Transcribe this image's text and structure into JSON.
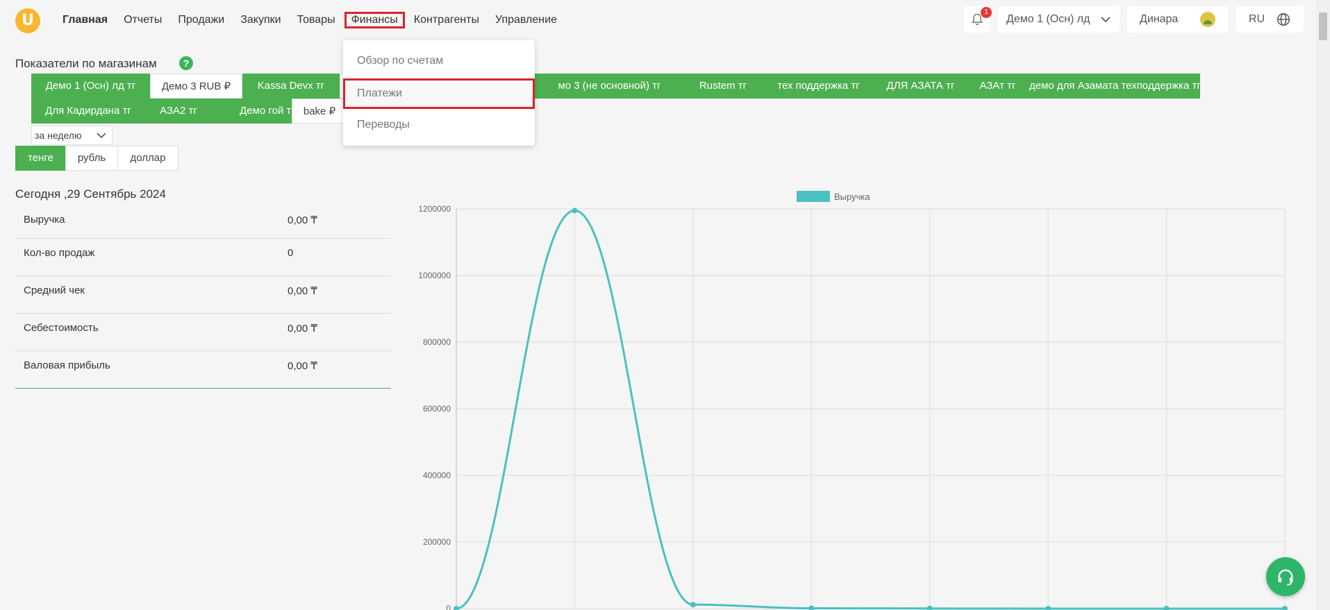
{
  "header": {
    "logo_letter": "U",
    "nav": [
      "Главная",
      "Отчеты",
      "Продажи",
      "Закупки",
      "Товары",
      "Финансы",
      "Контрагенты",
      "Управление"
    ],
    "notifications_count": "1",
    "store_selector": "Демо 1 (Осн) лд",
    "user_name": "Динара",
    "language": "RU"
  },
  "finance_menu": {
    "items": [
      "Обзор по счетам",
      "Платежи",
      "Переводы"
    ]
  },
  "section": {
    "title": "Показатели по магазинам",
    "help": "?"
  },
  "store_tabs": [
    "Демо 1 (Осн) лд тг",
    "Демо 3 RUB ₽",
    "Kassa Devx тг",
    "мо 3 (не основной) тг",
    "Rustem тг",
    "тех поддержка тг",
    "ДЛЯ АЗАТА тг",
    "АЗАт тг",
    "демо для Азамата техподдержка тг",
    "Для Кадирдана тг",
    "АЗА2 тг",
    "Демо гой тг",
    "bake ₽"
  ],
  "period": "за неделю",
  "currencies": [
    "тенге",
    "рубль",
    "доллар"
  ],
  "today": "Сегодня ,29 Сентябрь 2024",
  "kpis": [
    {
      "label": "Выручка",
      "value": "0,00 ₸"
    },
    {
      "label": "Кол-во продаж",
      "value": "0"
    },
    {
      "label": "Средний чек",
      "value": "0,00 ₸"
    },
    {
      "label": "Себестоимость",
      "value": "0,00 ₸"
    },
    {
      "label": "Валовая прибыль",
      "value": "0,00 ₸"
    }
  ],
  "colors": {
    "accent": "#4caf50",
    "line": "#4bc0c0",
    "highlight": "#d9232d"
  },
  "chart_data": {
    "type": "line",
    "legend": [
      "Выручка"
    ],
    "legend_position": "top",
    "grid": true,
    "y_ticks": [
      "1200000",
      "1000000",
      "800000",
      "600000",
      "400000",
      "200000",
      "0"
    ],
    "ylim": [
      0,
      1200000
    ],
    "series": [
      {
        "name": "Выручка",
        "values": [
          0,
          1195000,
          12000,
          1000,
          500,
          0,
          0,
          0
        ]
      }
    ]
  }
}
